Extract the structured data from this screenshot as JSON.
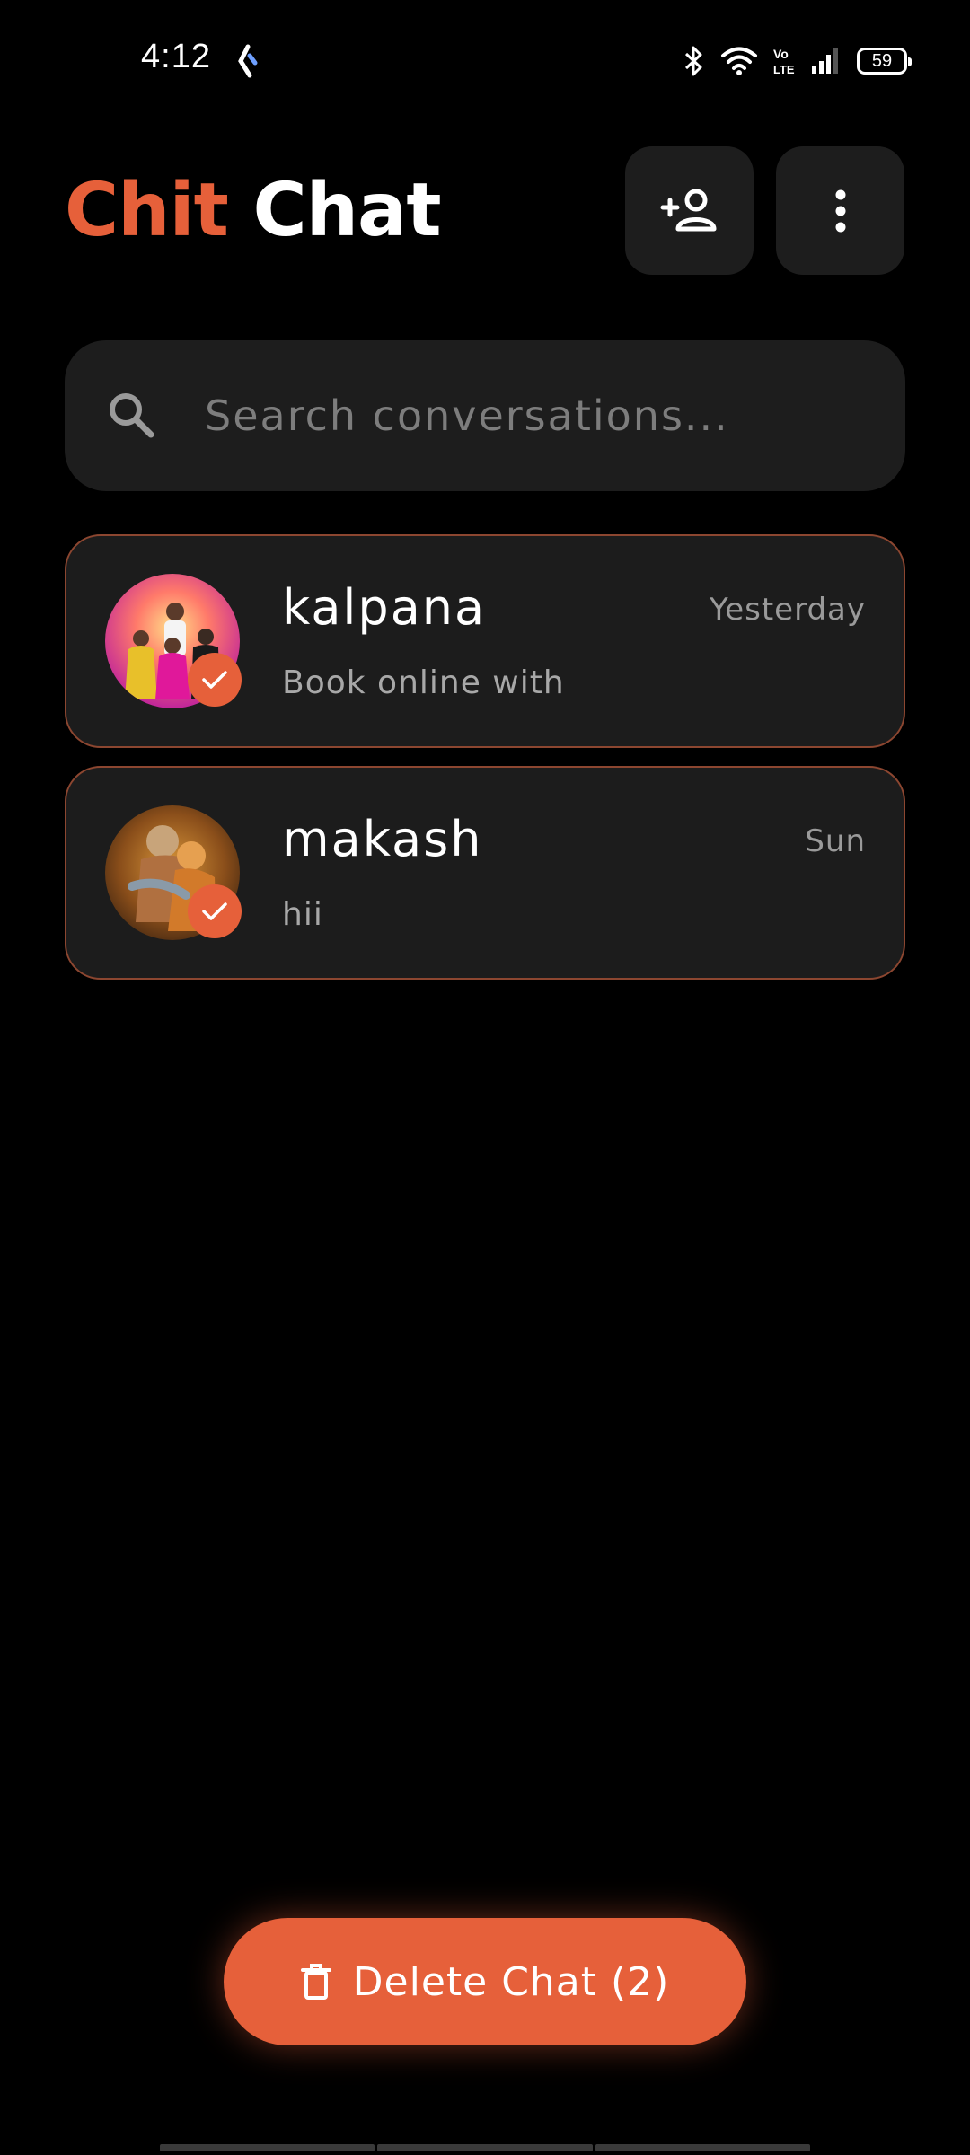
{
  "status_bar": {
    "time": "4:12",
    "battery": "59",
    "network_label": "Vo LTE"
  },
  "header": {
    "title_part1": "Chit",
    "title_part2": "Chat",
    "add_contact_icon": "person-add-icon",
    "more_icon": "more-vertical-icon"
  },
  "search": {
    "placeholder": "Search conversations...",
    "value": ""
  },
  "chats": [
    {
      "name": "kalpana",
      "time": "Yesterday",
      "preview": "Book online with",
      "selected": true
    },
    {
      "name": "makash",
      "time": "Sun",
      "preview": "hii",
      "selected": true
    }
  ],
  "delete_button": {
    "label": "Delete Chat (2)",
    "icon": "trash-icon"
  },
  "colors": {
    "accent": "#e6603a",
    "background": "#000000",
    "surface": "#1d1d1d",
    "card_border": "#8c4630"
  }
}
